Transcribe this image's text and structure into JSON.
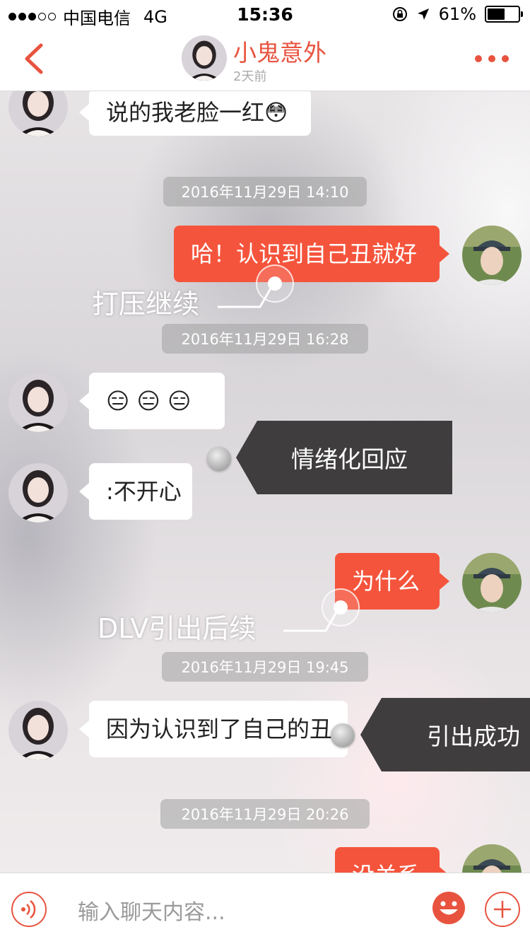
{
  "status_bar": {
    "carrier": "中国电信",
    "network": "4G",
    "time": "15:36",
    "battery": "61%",
    "battery_level": 0.61
  },
  "header": {
    "contact_name": "小鬼意外",
    "last_seen": "2天前",
    "back_icon": "chevron-left-icon",
    "more_icon": "ellipsis-icon",
    "accent_color": "#e8533f"
  },
  "messages": [
    {
      "side": "in",
      "text": "说的我老脸一红😳"
    },
    {
      "timestamp": "2016年11月29日 14:10"
    },
    {
      "side": "out",
      "text": "哈！认识到自己丑就好"
    },
    {
      "timestamp": "2016年11月29日 16:28"
    },
    {
      "side": "in",
      "text": "😑 😑 😑"
    },
    {
      "side": "in",
      "text": ":不开心"
    },
    {
      "side": "out",
      "text": "为什么"
    },
    {
      "timestamp": "2016年11月29日 19:45"
    },
    {
      "side": "in",
      "text": "因为认识到了自己的丑"
    },
    {
      "timestamp": "2016年11月29日 20:26"
    },
    {
      "side": "out",
      "text": "没关系"
    }
  ],
  "annotations": {
    "note1": "打压继续",
    "note2": "DLV引出后续",
    "tag1": "情绪化回应",
    "tag2": "引出成功"
  },
  "input_bar": {
    "placeholder": "输入聊天内容...",
    "voice_icon": "voice-icon",
    "emoji_icon": "emoji-icon",
    "plus_icon": "plus-icon"
  },
  "colors": {
    "outgoing_bubble": "#f5543c",
    "incoming_bubble": "#ffffff",
    "tag_background": "#3f3d3e"
  }
}
